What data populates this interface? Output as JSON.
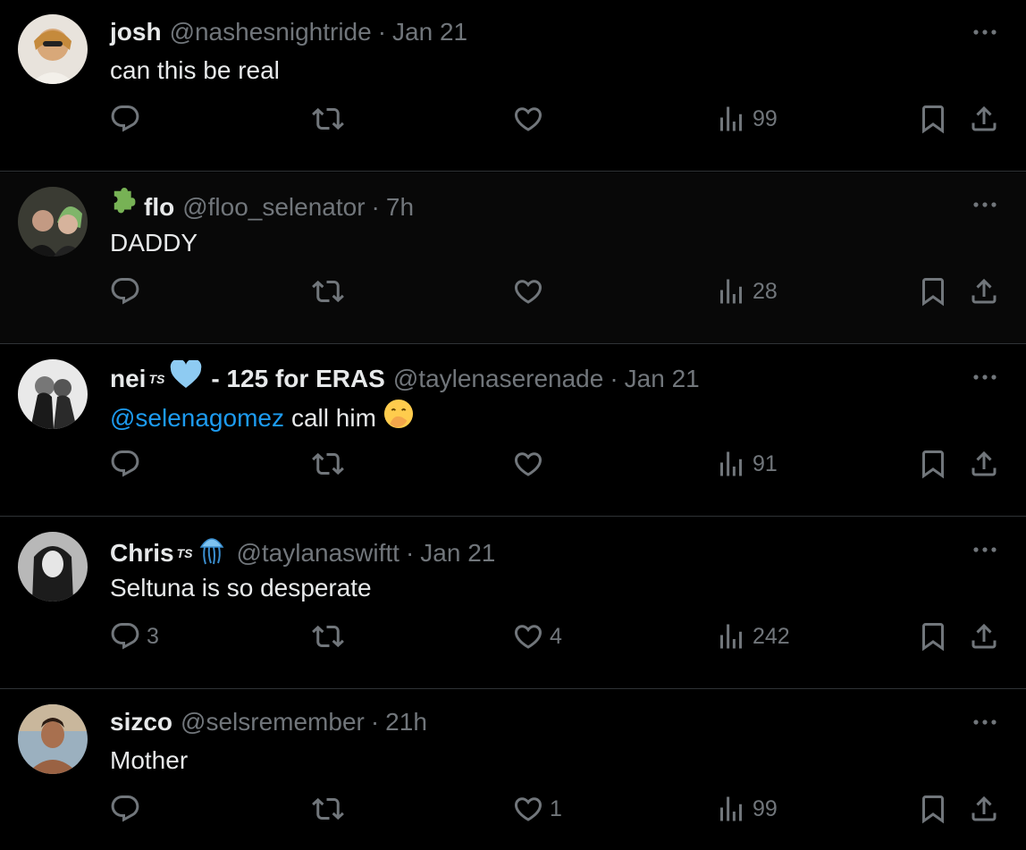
{
  "colors": {
    "background": "#000000",
    "text": "#e7e9ea",
    "muted": "#71767b",
    "link": "#1d9bf0",
    "divider": "#2f3336"
  },
  "tweets": [
    {
      "name": "josh",
      "handle": "@nashesnightride",
      "separator": "·",
      "time": "Jan 21",
      "text": "can this be real",
      "reply_count": "",
      "retweet_count": "",
      "like_count": "",
      "view_count": "99"
    },
    {
      "name_prefix_icon": "puzzle-piece-emoji",
      "name": "flo",
      "handle": "@floo_selenator",
      "separator": "·",
      "time": "7h",
      "text": "DADDY",
      "reply_count": "",
      "retweet_count": "",
      "like_count": "",
      "view_count": "28"
    },
    {
      "name": "nei",
      "name_tag": "TS",
      "name_emoji": "blue-heart-emoji",
      "name_suffix": "- 125 for ERAS",
      "handle": "@taylenaserenade",
      "separator": "·",
      "time": "Jan 21",
      "mention": "@selenagomez",
      "text": "call him",
      "text_emoji": "face-with-hand-over-mouth-emoji",
      "reply_count": "",
      "retweet_count": "",
      "like_count": "",
      "view_count": "91"
    },
    {
      "name": "Chris",
      "name_tag": "TS",
      "name_emoji": "jellyfish-emoji",
      "handle": "@taylanaswiftt",
      "separator": "·",
      "time": "Jan 21",
      "text": "Seltuna is so desperate",
      "reply_count": "3",
      "retweet_count": "",
      "like_count": "4",
      "view_count": "242"
    },
    {
      "name": "sizco",
      "handle": "@selsremember",
      "separator": "·",
      "time": "21h",
      "text": "Mother",
      "reply_count": "",
      "retweet_count": "",
      "like_count": "1",
      "view_count": "99"
    }
  ]
}
